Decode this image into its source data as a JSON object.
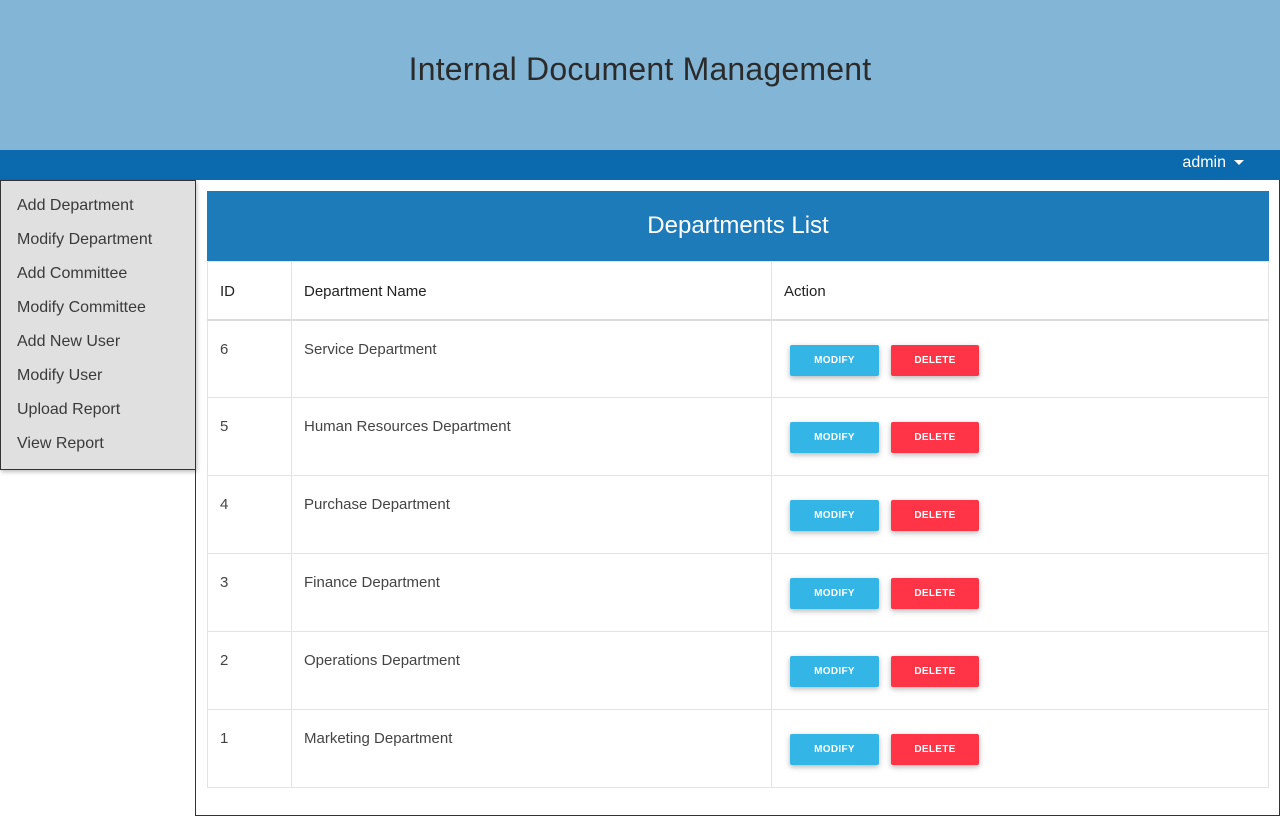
{
  "header": {
    "title": "Internal Document Management"
  },
  "navbar": {
    "user": "admin"
  },
  "sidebar": {
    "items": [
      {
        "label": "Add Department"
      },
      {
        "label": "Modify Department"
      },
      {
        "label": "Add Committee"
      },
      {
        "label": "Modify Committee"
      },
      {
        "label": "Add New User"
      },
      {
        "label": "Modify User"
      },
      {
        "label": "Upload Report"
      },
      {
        "label": "View Report"
      }
    ]
  },
  "main": {
    "title": "Departments List",
    "columns": {
      "id": "ID",
      "name": "Department Name",
      "action": "Action"
    },
    "modify_label": "MODIFY",
    "delete_label": "DELETE",
    "rows": [
      {
        "id": "6",
        "name": "Service Department"
      },
      {
        "id": "5",
        "name": "Human Resources Department"
      },
      {
        "id": "4",
        "name": "Purchase Department"
      },
      {
        "id": "3",
        "name": "Finance Department"
      },
      {
        "id": "2",
        "name": "Operations Department"
      },
      {
        "id": "1",
        "name": "Marketing Department"
      }
    ]
  },
  "colors": {
    "banner": "#82b5d6",
    "navbar": "#0b6aae",
    "panel_header": "#1e7bb9",
    "modify_button": "#33b5e5",
    "delete_button": "#ff3547",
    "sidebar_bg": "#e0e0e0"
  }
}
